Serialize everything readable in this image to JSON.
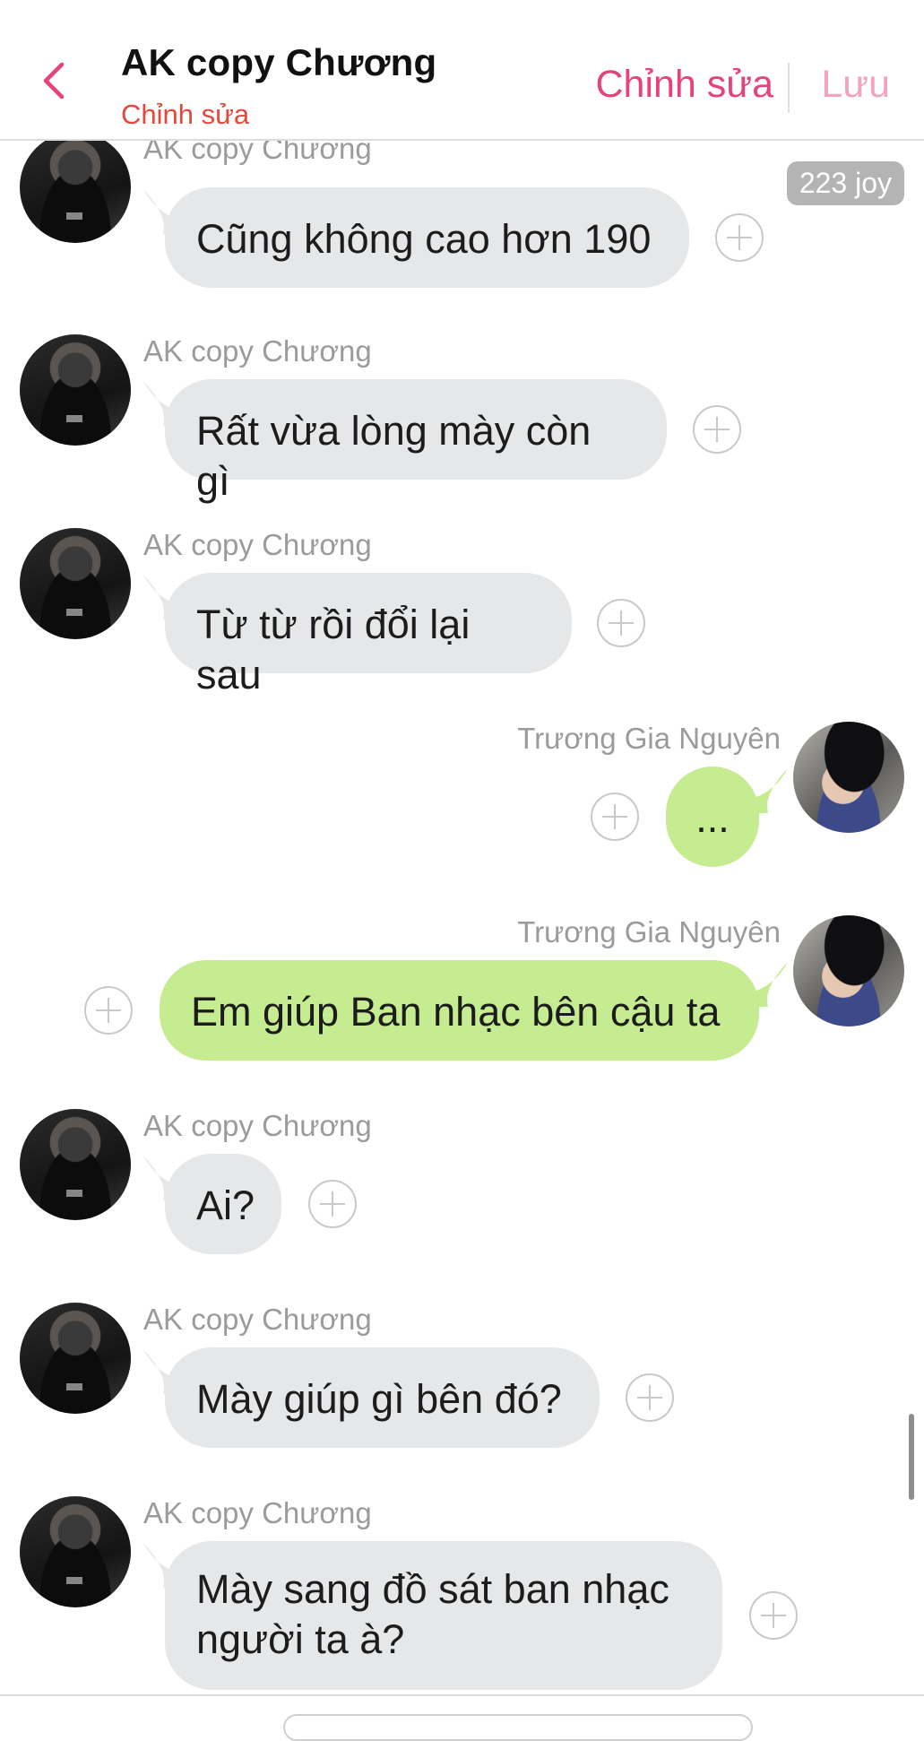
{
  "header": {
    "title": "AK copy Chương",
    "subtitle": "Chỉnh sửa",
    "edit_label": "Chỉnh sửa",
    "save_label": "Lưu"
  },
  "badge": {
    "text": "223 joy"
  },
  "colors": {
    "accent": "#e7427a",
    "accent_light": "#f2a3bf",
    "subtitle_red": "#e5483c",
    "bubble_gray": "#e5e7e9",
    "bubble_green": "#c6ec92"
  },
  "messages": [
    {
      "sender": "AK copy Chương",
      "side": "left",
      "text": "Cũng không cao hơn 190"
    },
    {
      "sender": "AK copy Chương",
      "side": "left",
      "text": "Rất vừa lòng mày còn gì"
    },
    {
      "sender": "AK copy Chương",
      "side": "left",
      "text": "Từ từ rồi đổi lại sau"
    },
    {
      "sender": "Trương Gia Nguyên",
      "side": "right",
      "text": "..."
    },
    {
      "sender": "Trương Gia Nguyên",
      "side": "right",
      "text": "Em giúp Ban nhạc bên cậu ta"
    },
    {
      "sender": "AK copy Chương",
      "side": "left",
      "text": "Ai?"
    },
    {
      "sender": "AK copy Chương",
      "side": "left",
      "text": "Mày giúp gì bên đó?"
    },
    {
      "sender": "AK copy Chương",
      "side": "left",
      "text_line1": "Mày sang đồ sát ban nhạc",
      "text_line2": "người ta à?"
    }
  ],
  "icons": {
    "back": "chevron-left-icon",
    "add": "plus-circle-icon"
  }
}
